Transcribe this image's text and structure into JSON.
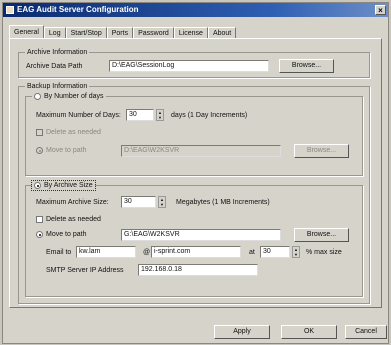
{
  "window": {
    "title": "EAG Audit Server Configuration",
    "close_glyph": "×"
  },
  "tabs": [
    "General",
    "Log",
    "Start/Stop",
    "Ports",
    "Password",
    "License",
    "About"
  ],
  "archive": {
    "group_label": "Archive Information",
    "path_label": "Archive Data Path",
    "path_value": "D:\\EAG\\SessionLog",
    "browse": "Browse..."
  },
  "backup": {
    "group_label": "Backup Information",
    "by_days": {
      "radio_label": "By Number of days",
      "selected": false,
      "max_label": "Maximum Number of Days:",
      "max_value": "30",
      "unit": "days (1 Day Increments)",
      "delete_label": "Delete as needed",
      "move_label": "Move to path",
      "move_path": "D:\\EAG\\W2KSVR",
      "browse": "Browse..."
    },
    "by_size": {
      "radio_label": "By Archive Size",
      "selected": true,
      "max_label": "Maximum Archive Size:",
      "max_value": "30",
      "unit": "Megabytes (1 MB Increments)",
      "delete_label": "Delete as needed",
      "move_label": "Move to path",
      "move_path": "G:\\EAG\\W2KSVR",
      "browse": "Browse...",
      "email_label": "Email to",
      "email_user": "kw.lam",
      "at_sign": "@",
      "email_domain": "i-sprint.com",
      "at_label": "at",
      "pct_value": "30",
      "pct_label": "% max size",
      "smtp_label": "SMTP Server IP Address",
      "smtp_value": "192.168.0.18"
    }
  },
  "buttons": {
    "apply": "Apply",
    "ok": "OK",
    "cancel": "Cancel"
  }
}
